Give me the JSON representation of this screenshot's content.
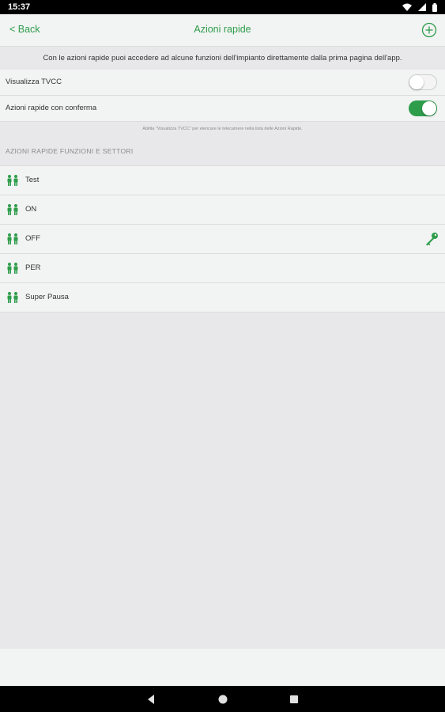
{
  "status_bar": {
    "time": "15:37"
  },
  "header": {
    "back_label": "< Back",
    "title": "Azioni rapide"
  },
  "intro_text": "Con le azioni rapide puoi accedere ad alcune funzioni dell'impianto direttamente dalla prima pagina dell'app.",
  "toggles": [
    {
      "label": "Visualizza TVCC",
      "state": "off"
    },
    {
      "label": "Azioni rapide con conferma",
      "state": "on"
    }
  ],
  "hint": "Abilita \"Visualizza TVCC\" per elencare le telecamere nella lista delle Azioni Rapide.",
  "section_header": "AZIONI RAPIDE FUNZIONI E SETTORI",
  "items": [
    {
      "label": "Test",
      "icon": "people-icon"
    },
    {
      "label": "ON",
      "icon": "people-icon"
    },
    {
      "label": "OFF",
      "icon": "people-icon",
      "trailing_icon": "key-icon"
    },
    {
      "label": "PER",
      "icon": "people-icon"
    },
    {
      "label": "Super Pausa",
      "icon": "people-icon"
    }
  ],
  "colors": {
    "accent": "#2e9d4b",
    "background": "#e8e8ea",
    "row_background": "#f2f3f3"
  }
}
